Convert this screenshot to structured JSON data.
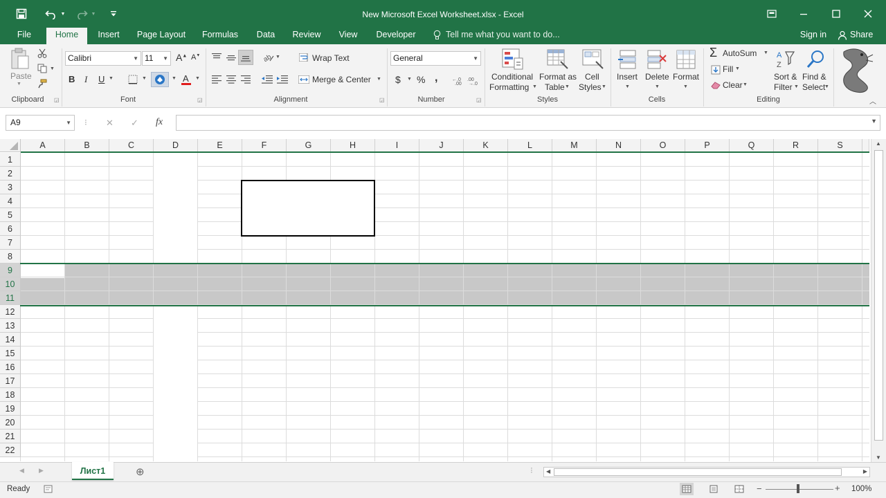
{
  "window": {
    "title": "New Microsoft Excel Worksheet.xlsx - Excel"
  },
  "tabs": {
    "file": "File",
    "home": "Home",
    "insert": "Insert",
    "page_layout": "Page Layout",
    "formulas": "Formulas",
    "data": "Data",
    "review": "Review",
    "view": "View",
    "developer": "Developer",
    "tell_me": "Tell me what you want to do...",
    "sign_in": "Sign in",
    "share": "Share"
  },
  "ribbon": {
    "clipboard": {
      "paste": "Paste",
      "label": "Clipboard"
    },
    "font": {
      "name": "Calibri",
      "size": "11",
      "bold": "B",
      "italic": "I",
      "underline": "U",
      "label": "Font"
    },
    "alignment": {
      "wrap_text": "Wrap Text",
      "merge_center": "Merge & Center",
      "label": "Alignment"
    },
    "number": {
      "format": "General",
      "currency": "$",
      "percent": "%",
      "comma": ",",
      "label": "Number"
    },
    "styles": {
      "conditional_1": "Conditional",
      "conditional_2": "Formatting",
      "format_table_1": "Format as",
      "format_table_2": "Table",
      "cell_styles_1": "Cell",
      "cell_styles_2": "Styles",
      "label": "Styles"
    },
    "cells": {
      "insert": "Insert",
      "delete": "Delete",
      "format": "Format",
      "label": "Cells"
    },
    "editing": {
      "autosum": "AutoSum",
      "fill": "Fill",
      "clear": "Clear",
      "sort_1": "Sort &",
      "sort_2": "Filter",
      "find_1": "Find &",
      "find_2": "Select",
      "label": "Editing"
    }
  },
  "formula_bar": {
    "name_box": "A9",
    "fx": "fx",
    "value": ""
  },
  "grid": {
    "columns": [
      "A",
      "B",
      "C",
      "D",
      "E",
      "F",
      "G",
      "H",
      "I",
      "J",
      "K",
      "L",
      "M",
      "N",
      "O",
      "P",
      "Q",
      "R",
      "S"
    ],
    "rows": [
      "1",
      "2",
      "3",
      "4",
      "5",
      "6",
      "7",
      "8",
      "9",
      "10",
      "11",
      "12",
      "13",
      "14",
      "15",
      "16",
      "17",
      "18",
      "19",
      "20",
      "21",
      "22"
    ],
    "selected_rows": [
      "9",
      "10",
      "11"
    ]
  },
  "sheets": {
    "active": "Лист1"
  },
  "status": {
    "ready": "Ready",
    "zoom": "100%"
  },
  "colors": {
    "accent": "#217346",
    "selection": "#c8c8c8"
  }
}
